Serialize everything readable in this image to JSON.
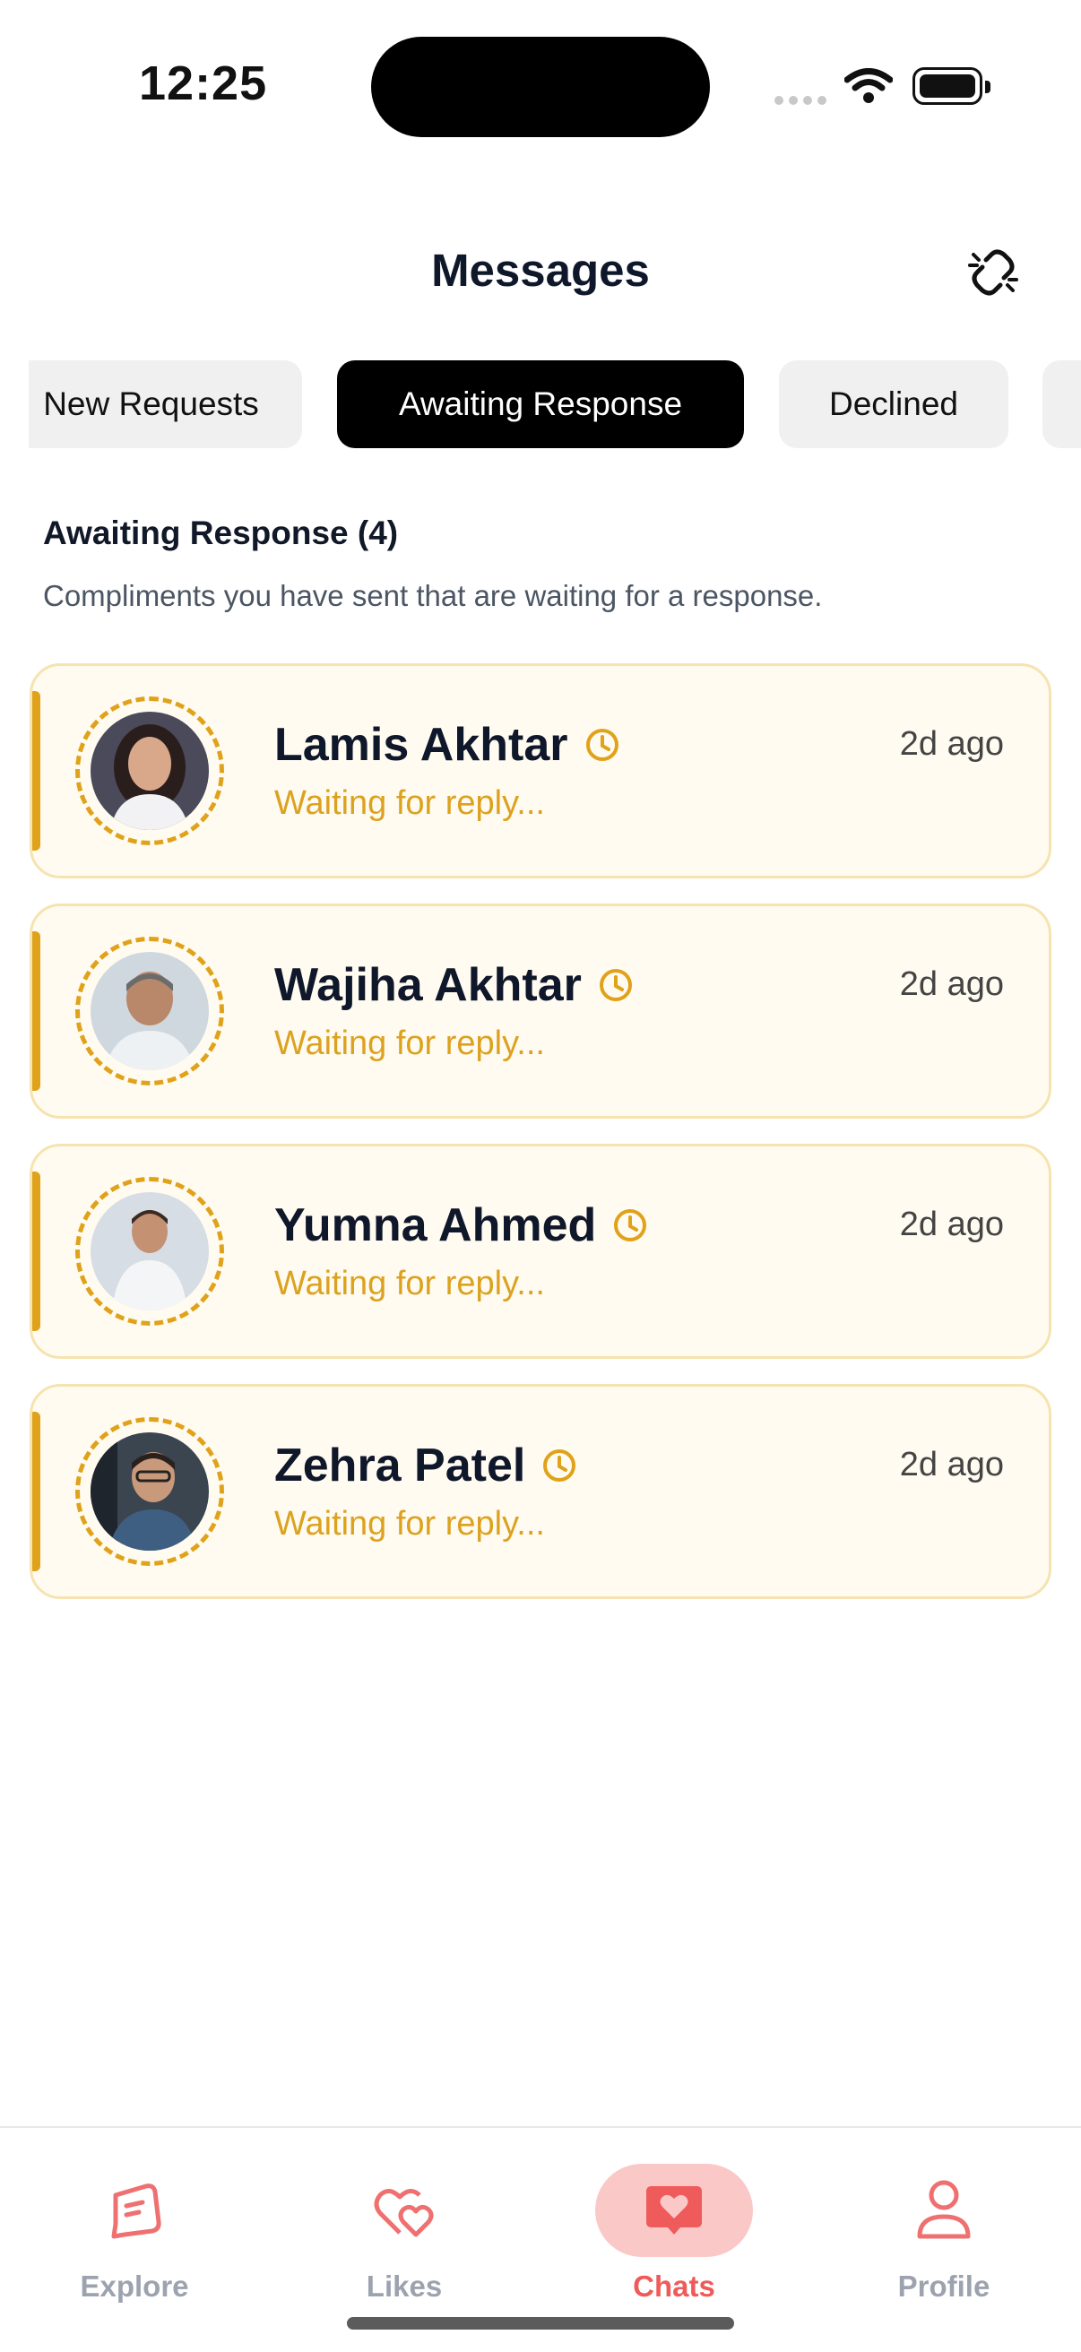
{
  "status_bar": {
    "time": "12:25"
  },
  "header": {
    "title": "Messages",
    "icon": "link-break-icon"
  },
  "tabs": [
    {
      "label": "New Requests",
      "active": false
    },
    {
      "label": "Awaiting Response",
      "active": true
    },
    {
      "label": "Declined",
      "active": false
    }
  ],
  "section": {
    "title": "Awaiting Response (4)",
    "subtitle": "Compliments you have sent that are waiting for a response."
  },
  "chats": [
    {
      "name": "Lamis Akhtar",
      "preview": "Waiting for reply...",
      "time": "2d ago"
    },
    {
      "name": "Wajiha Akhtar",
      "preview": "Waiting for reply...",
      "time": "2d ago"
    },
    {
      "name": "Yumna Ahmed",
      "preview": "Waiting for reply...",
      "time": "2d ago"
    },
    {
      "name": "Zehra Patel",
      "preview": "Waiting for reply...",
      "time": "2d ago"
    }
  ],
  "nav": {
    "explore": "Explore",
    "likes": "Likes",
    "chats": "Chats",
    "profile": "Profile"
  },
  "colors": {
    "accent": "#e0a21a",
    "nav_active": "#ef5a5a",
    "card_bg": "#fffbf0"
  }
}
